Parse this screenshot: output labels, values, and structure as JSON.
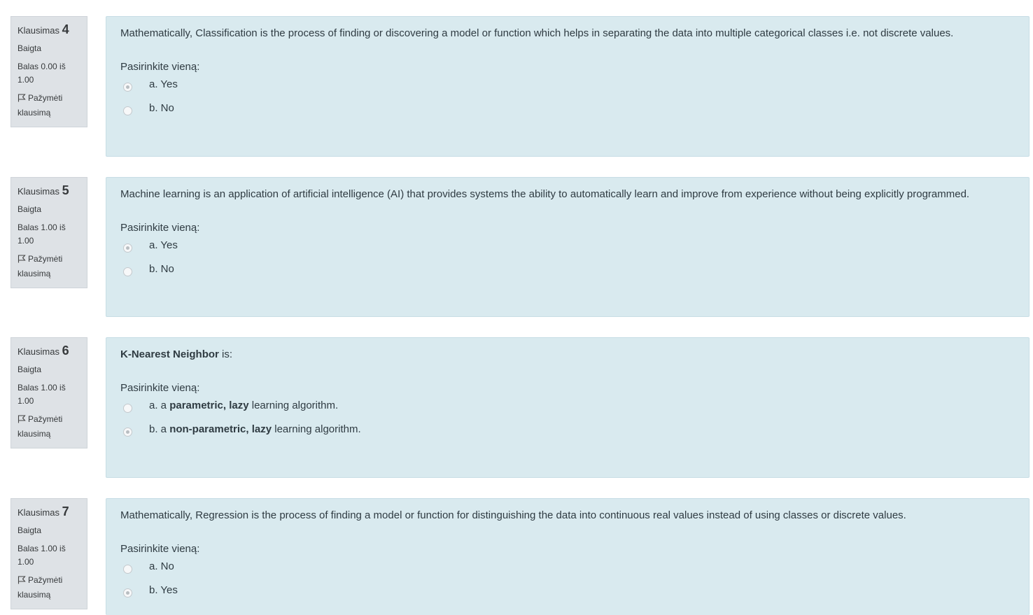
{
  "labels": {
    "klausimas": "Klausimas",
    "state": "Baigta",
    "flag": "Pažymėti",
    "flag2": "klausimą",
    "prompt": "Pasirinkite vieną:"
  },
  "questions": [
    {
      "number": "4",
      "score_line1": "Balas 0.00 iš",
      "score_line2": "1.00",
      "text": "Mathematically, Classification is the process of finding or discovering a model or function which helps in separating the data into multiple categorical classes i.e.  not discrete values.",
      "answers": [
        {
          "label": "a. Yes",
          "selected": true
        },
        {
          "label": "b. No",
          "selected": false
        }
      ]
    },
    {
      "number": "5",
      "score_line1": "Balas 1.00 iš",
      "score_line2": "1.00",
      "text": "Machine learning is an application of artificial intelligence (AI) that provides systems the ability to automatically learn and improve from experience without being explicitly programmed.",
      "answers": [
        {
          "label": "a. Yes",
          "selected": true
        },
        {
          "label": "b. No",
          "selected": false
        }
      ]
    },
    {
      "number": "6",
      "score_line1": "Balas 1.00 iš",
      "score_line2": "1.00",
      "text_bold": "K-Nearest Neighbor",
      "text_rest": " is:",
      "answers": [
        {
          "prefix": "a. a ",
          "bold": "parametric, lazy",
          "suffix": " learning algorithm.",
          "selected": false
        },
        {
          "prefix": "b. a ",
          "bold": "non-parametric, lazy",
          "suffix": " learning algorithm.",
          "selected": true
        }
      ]
    },
    {
      "number": "7",
      "score_line1": "Balas 1.00 iš",
      "score_line2": "1.00",
      "text": "Mathematically, Regression is the process of finding a model or function for distinguishing the data into continuous real values instead of using classes or discrete values.",
      "answers": [
        {
          "label": "a. No",
          "selected": false
        },
        {
          "label": "b. Yes",
          "selected": true
        }
      ]
    }
  ]
}
